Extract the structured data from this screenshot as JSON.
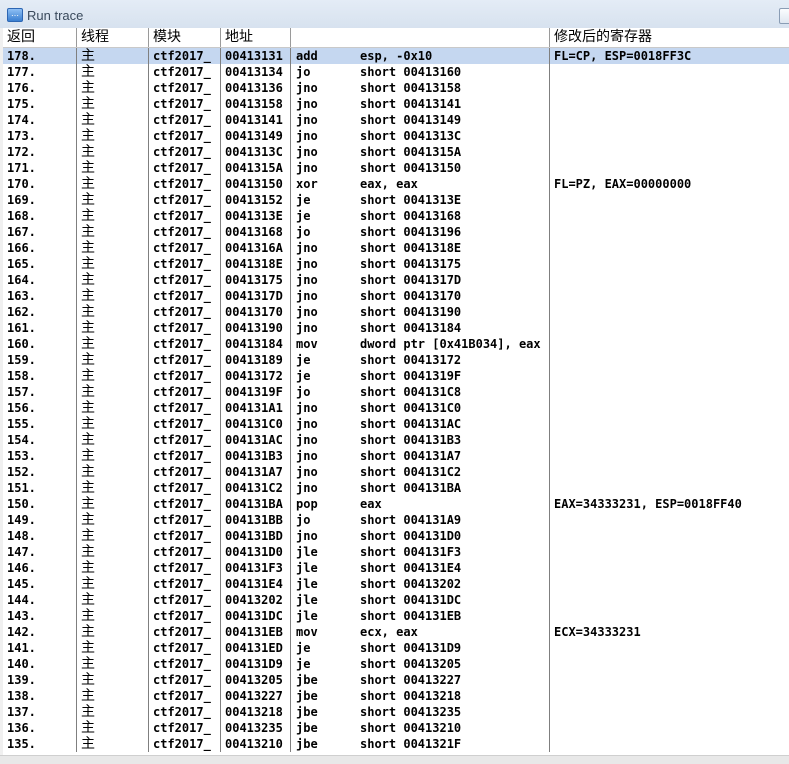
{
  "window": {
    "title": "Run trace"
  },
  "columns": {
    "back": "返回",
    "thread": "线程",
    "module": "模块",
    "address": "地址",
    "command": "",
    "registers": "修改后的寄存器"
  },
  "rows": [
    {
      "back": "178.",
      "thread": "主",
      "module": "ctf2017_",
      "address": "00413131",
      "mnemonic": "add",
      "operands": "esp, -0x10",
      "regs": "FL=CP, ESP=0018FF3C",
      "selected": true
    },
    {
      "back": "177.",
      "thread": "主",
      "module": "ctf2017_",
      "address": "00413134",
      "mnemonic": "jo",
      "operands": "short 00413160",
      "regs": ""
    },
    {
      "back": "176.",
      "thread": "主",
      "module": "ctf2017_",
      "address": "00413136",
      "mnemonic": "jno",
      "operands": "short 00413158",
      "regs": ""
    },
    {
      "back": "175.",
      "thread": "主",
      "module": "ctf2017_",
      "address": "00413158",
      "mnemonic": "jno",
      "operands": "short 00413141",
      "regs": ""
    },
    {
      "back": "174.",
      "thread": "主",
      "module": "ctf2017_",
      "address": "00413141",
      "mnemonic": "jno",
      "operands": "short 00413149",
      "regs": ""
    },
    {
      "back": "173.",
      "thread": "主",
      "module": "ctf2017_",
      "address": "00413149",
      "mnemonic": "jno",
      "operands": "short 0041313C",
      "regs": ""
    },
    {
      "back": "172.",
      "thread": "主",
      "module": "ctf2017_",
      "address": "0041313C",
      "mnemonic": "jno",
      "operands": "short 0041315A",
      "regs": ""
    },
    {
      "back": "171.",
      "thread": "主",
      "module": "ctf2017_",
      "address": "0041315A",
      "mnemonic": "jno",
      "operands": "short 00413150",
      "regs": ""
    },
    {
      "back": "170.",
      "thread": "主",
      "module": "ctf2017_",
      "address": "00413150",
      "mnemonic": "xor",
      "operands": "eax, eax",
      "regs": "FL=PZ, EAX=00000000"
    },
    {
      "back": "169.",
      "thread": "主",
      "module": "ctf2017_",
      "address": "00413152",
      "mnemonic": "je",
      "operands": "short 0041313E",
      "regs": ""
    },
    {
      "back": "168.",
      "thread": "主",
      "module": "ctf2017_",
      "address": "0041313E",
      "mnemonic": "je",
      "operands": "short 00413168",
      "regs": ""
    },
    {
      "back": "167.",
      "thread": "主",
      "module": "ctf2017_",
      "address": "00413168",
      "mnemonic": "jo",
      "operands": "short 00413196",
      "regs": ""
    },
    {
      "back": "166.",
      "thread": "主",
      "module": "ctf2017_",
      "address": "0041316A",
      "mnemonic": "jno",
      "operands": "short 0041318E",
      "regs": ""
    },
    {
      "back": "165.",
      "thread": "主",
      "module": "ctf2017_",
      "address": "0041318E",
      "mnemonic": "jno",
      "operands": "short 00413175",
      "regs": ""
    },
    {
      "back": "164.",
      "thread": "主",
      "module": "ctf2017_",
      "address": "00413175",
      "mnemonic": "jno",
      "operands": "short 0041317D",
      "regs": ""
    },
    {
      "back": "163.",
      "thread": "主",
      "module": "ctf2017_",
      "address": "0041317D",
      "mnemonic": "jno",
      "operands": "short 00413170",
      "regs": ""
    },
    {
      "back": "162.",
      "thread": "主",
      "module": "ctf2017_",
      "address": "00413170",
      "mnemonic": "jno",
      "operands": "short 00413190",
      "regs": ""
    },
    {
      "back": "161.",
      "thread": "主",
      "module": "ctf2017_",
      "address": "00413190",
      "mnemonic": "jno",
      "operands": "short 00413184",
      "regs": ""
    },
    {
      "back": "160.",
      "thread": "主",
      "module": "ctf2017_",
      "address": "00413184",
      "mnemonic": "mov",
      "operands": "dword ptr [0x41B034], eax",
      "regs": ""
    },
    {
      "back": "159.",
      "thread": "主",
      "module": "ctf2017_",
      "address": "00413189",
      "mnemonic": "je",
      "operands": "short 00413172",
      "regs": ""
    },
    {
      "back": "158.",
      "thread": "主",
      "module": "ctf2017_",
      "address": "00413172",
      "mnemonic": "je",
      "operands": "short 0041319F",
      "regs": ""
    },
    {
      "back": "157.",
      "thread": "主",
      "module": "ctf2017_",
      "address": "0041319F",
      "mnemonic": "jo",
      "operands": "short 004131C8",
      "regs": ""
    },
    {
      "back": "156.",
      "thread": "主",
      "module": "ctf2017_",
      "address": "004131A1",
      "mnemonic": "jno",
      "operands": "short 004131C0",
      "regs": ""
    },
    {
      "back": "155.",
      "thread": "主",
      "module": "ctf2017_",
      "address": "004131C0",
      "mnemonic": "jno",
      "operands": "short 004131AC",
      "regs": ""
    },
    {
      "back": "154.",
      "thread": "主",
      "module": "ctf2017_",
      "address": "004131AC",
      "mnemonic": "jno",
      "operands": "short 004131B3",
      "regs": ""
    },
    {
      "back": "153.",
      "thread": "主",
      "module": "ctf2017_",
      "address": "004131B3",
      "mnemonic": "jno",
      "operands": "short 004131A7",
      "regs": ""
    },
    {
      "back": "152.",
      "thread": "主",
      "module": "ctf2017_",
      "address": "004131A7",
      "mnemonic": "jno",
      "operands": "short 004131C2",
      "regs": ""
    },
    {
      "back": "151.",
      "thread": "主",
      "module": "ctf2017_",
      "address": "004131C2",
      "mnemonic": "jno",
      "operands": "short 004131BA",
      "regs": ""
    },
    {
      "back": "150.",
      "thread": "主",
      "module": "ctf2017_",
      "address": "004131BA",
      "mnemonic": "pop",
      "operands": "eax",
      "regs": "EAX=34333231, ESP=0018FF40"
    },
    {
      "back": "149.",
      "thread": "主",
      "module": "ctf2017_",
      "address": "004131BB",
      "mnemonic": "jo",
      "operands": "short 004131A9",
      "regs": ""
    },
    {
      "back": "148.",
      "thread": "主",
      "module": "ctf2017_",
      "address": "004131BD",
      "mnemonic": "jno",
      "operands": "short 004131D0",
      "regs": ""
    },
    {
      "back": "147.",
      "thread": "主",
      "module": "ctf2017_",
      "address": "004131D0",
      "mnemonic": "jle",
      "operands": "short 004131F3",
      "regs": ""
    },
    {
      "back": "146.",
      "thread": "主",
      "module": "ctf2017_",
      "address": "004131F3",
      "mnemonic": "jle",
      "operands": "short 004131E4",
      "regs": ""
    },
    {
      "back": "145.",
      "thread": "主",
      "module": "ctf2017_",
      "address": "004131E4",
      "mnemonic": "jle",
      "operands": "short 00413202",
      "regs": ""
    },
    {
      "back": "144.",
      "thread": "主",
      "module": "ctf2017_",
      "address": "00413202",
      "mnemonic": "jle",
      "operands": "short 004131DC",
      "regs": ""
    },
    {
      "back": "143.",
      "thread": "主",
      "module": "ctf2017_",
      "address": "004131DC",
      "mnemonic": "jle",
      "operands": "short 004131EB",
      "regs": ""
    },
    {
      "back": "142.",
      "thread": "主",
      "module": "ctf2017_",
      "address": "004131EB",
      "mnemonic": "mov",
      "operands": "ecx, eax",
      "regs": "ECX=34333231"
    },
    {
      "back": "141.",
      "thread": "主",
      "module": "ctf2017_",
      "address": "004131ED",
      "mnemonic": "je",
      "operands": "short 004131D9",
      "regs": ""
    },
    {
      "back": "140.",
      "thread": "主",
      "module": "ctf2017_",
      "address": "004131D9",
      "mnemonic": "je",
      "operands": "short 00413205",
      "regs": ""
    },
    {
      "back": "139.",
      "thread": "主",
      "module": "ctf2017_",
      "address": "00413205",
      "mnemonic": "jbe",
      "operands": "short 00413227",
      "regs": ""
    },
    {
      "back": "138.",
      "thread": "主",
      "module": "ctf2017_",
      "address": "00413227",
      "mnemonic": "jbe",
      "operands": "short 00413218",
      "regs": ""
    },
    {
      "back": "137.",
      "thread": "主",
      "module": "ctf2017_",
      "address": "00413218",
      "mnemonic": "jbe",
      "operands": "short 00413235",
      "regs": ""
    },
    {
      "back": "136.",
      "thread": "主",
      "module": "ctf2017_",
      "address": "00413235",
      "mnemonic": "jbe",
      "operands": "short 00413210",
      "regs": ""
    },
    {
      "back": "135.",
      "thread": "主",
      "module": "ctf2017_",
      "address": "00413210",
      "mnemonic": "jbe",
      "operands": "short 0041321F",
      "regs": ""
    }
  ]
}
